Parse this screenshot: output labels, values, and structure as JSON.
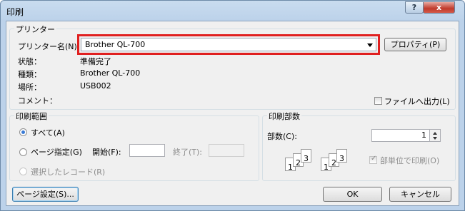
{
  "window": {
    "title": "印刷",
    "help": "?",
    "close": "x"
  },
  "printer": {
    "group_label": "プリンター",
    "name_label": "プリンター名(N):",
    "selected": "Brother QL-700",
    "properties_btn": "プロパティ(P)",
    "status_label": "状態：",
    "status_value": "準備完了",
    "type_label": "種類：",
    "type_value": "Brother QL-700",
    "where_label": "場所：",
    "where_value": "USB002",
    "comment_label": "コメント：",
    "print_to_file": "ファイルへ出力(L)"
  },
  "range": {
    "group_label": "印刷範囲",
    "all": "すべて(A)",
    "pages": "ページ指定(G)",
    "from_label": "開始(F):",
    "to_label": "終了(T):",
    "selection": "選択したレコード(R)"
  },
  "copies": {
    "group_label": "印刷部数",
    "count_label": "部数(C):",
    "count_value": "1",
    "collate_label": "部単位で印刷(O)",
    "sheet_numbers": [
      "1",
      "2",
      "3"
    ]
  },
  "footer": {
    "page_setup": "ページ設定(S)...",
    "ok": "OK",
    "cancel": "キャンセル"
  }
}
